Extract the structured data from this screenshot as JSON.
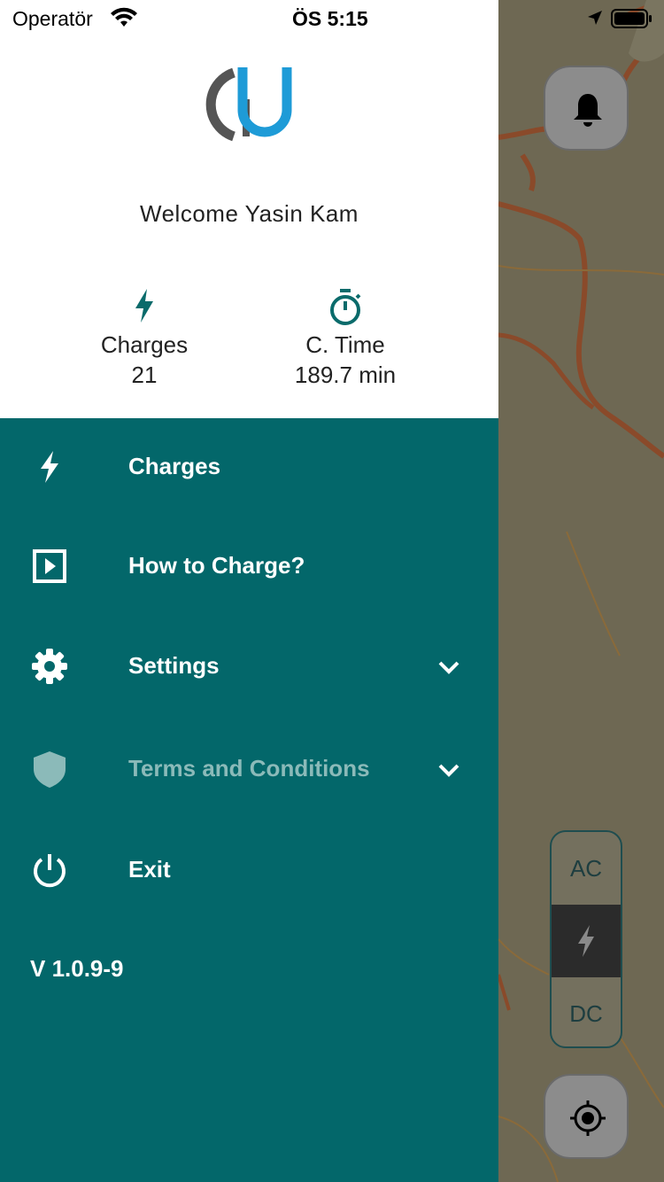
{
  "status_bar": {
    "carrier": "Operatör",
    "time": "ÖS 5:15"
  },
  "profile": {
    "welcome": "Welcome Yasin Kam"
  },
  "stats": {
    "charges_label": "Charges",
    "charges_value": "21",
    "time_label": "C. Time",
    "time_value": "189.7 min"
  },
  "menu": {
    "items": [
      {
        "label": "Charges",
        "icon": "bolt-icon"
      },
      {
        "label": "How to Charge?",
        "icon": "play-box-icon"
      },
      {
        "label": "Settings",
        "icon": "gear-icon",
        "expandable": true
      },
      {
        "label": "Terms and Conditions",
        "icon": "shield-icon",
        "expandable": true
      },
      {
        "label": "Exit",
        "icon": "power-icon"
      }
    ]
  },
  "version": "V 1.0.9-9",
  "map_controls": {
    "ac_label": "AC",
    "dc_label": "DC"
  },
  "colors": {
    "drawer": "#03676a",
    "accent_teal": "#0a6b6b",
    "logo_blue": "#1e9bd7",
    "logo_gray": "#555555"
  }
}
